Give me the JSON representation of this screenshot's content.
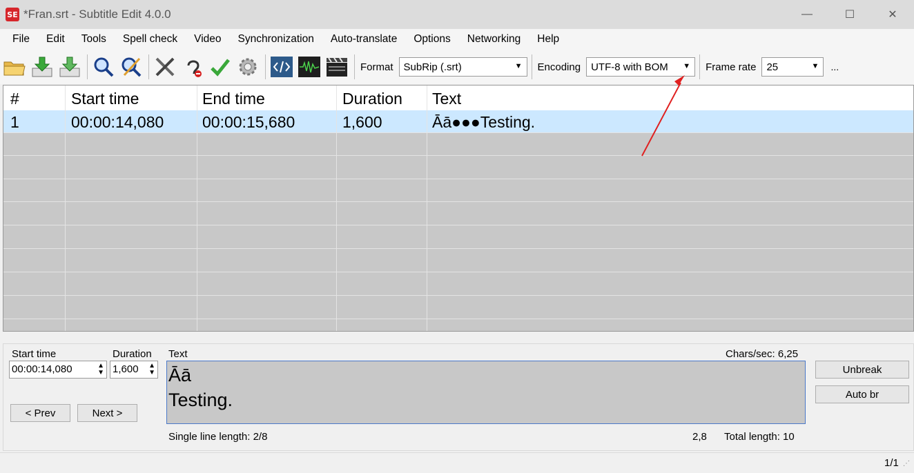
{
  "window": {
    "app_icon_text": "SE",
    "title": "*Fran.srt - Subtitle Edit 4.0.0",
    "minimize": "—",
    "maximize": "☐",
    "close": "✕"
  },
  "menu": [
    "File",
    "Edit",
    "Tools",
    "Spell check",
    "Video",
    "Synchronization",
    "Auto-translate",
    "Options",
    "Networking",
    "Help"
  ],
  "toolbar": {
    "format_label": "Format",
    "format_value": "SubRip (.srt)",
    "encoding_label": "Encoding",
    "encoding_value": "UTF-8 with BOM",
    "framerate_label": "Frame rate",
    "framerate_value": "25",
    "more": "...",
    "icons": [
      "open-folder-icon",
      "download-icon",
      "download-alt-icon",
      "find-icon",
      "replace-icon",
      "tools-icon",
      "hearing-impaired-icon",
      "spell-check-icon",
      "settings-icon",
      "source-view-icon",
      "waveform-icon",
      "video-clapper-icon"
    ]
  },
  "grid": {
    "headers": [
      "#",
      "Start time",
      "End time",
      "Duration",
      "Text"
    ],
    "rows": [
      {
        "number": "1",
        "start": "00:00:14,080",
        "end": "00:00:15,680",
        "duration": "1,600",
        "text": "Āā●●●Testing."
      }
    ]
  },
  "editor": {
    "start_time_label": "Start time",
    "start_time_value": "00:00:14,080",
    "duration_label": "Duration",
    "duration_value": "1,600",
    "text_label": "Text",
    "chars_sec": "Chars/sec: 6,25",
    "text_line1": "Āā",
    "text_line2": "Testing.",
    "prev_button": "< Prev",
    "next_button": "Next >",
    "unbreak_button": "Unbreak",
    "auto_br_button": "Auto br",
    "single_line_length": "Single line length: 2/8",
    "line_ratio": "2,8",
    "total_length": "Total length: 10"
  },
  "status": {
    "position": "1/1"
  },
  "colors": {
    "selected_row": "#cce8ff",
    "annotation_arrow": "#e02020",
    "grid_background": "#c8c8c8"
  }
}
